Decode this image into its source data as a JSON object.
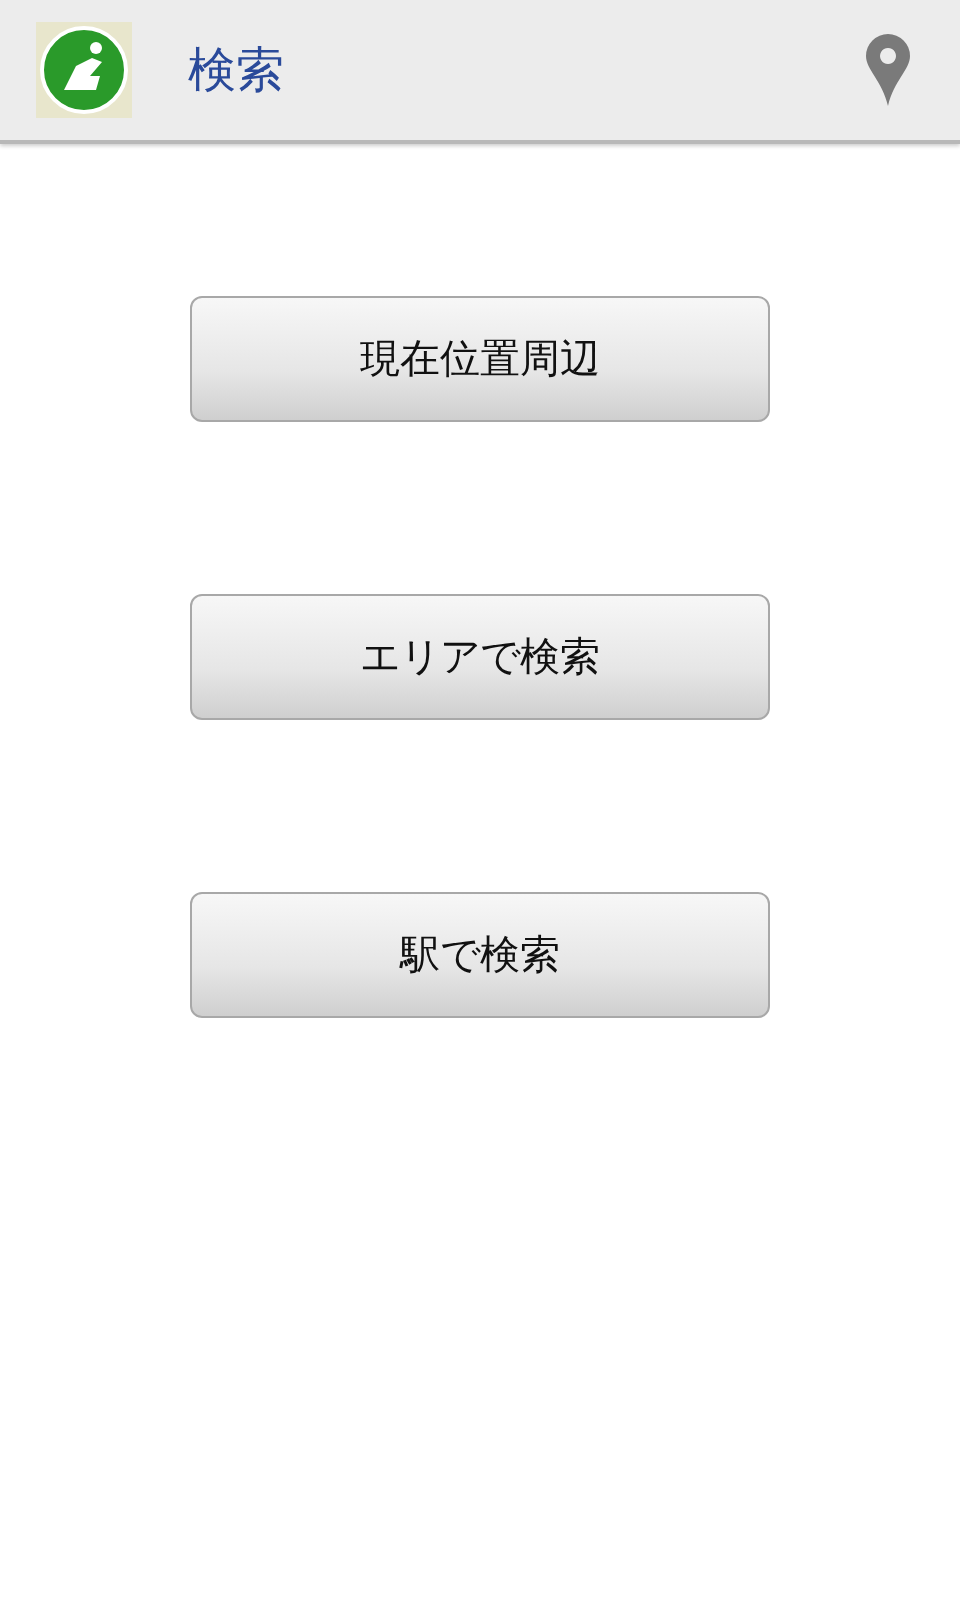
{
  "action_bar": {
    "title": "検索"
  },
  "buttons": [
    {
      "label": "現在位置周辺"
    },
    {
      "label": "エリアで検索"
    },
    {
      "label": "駅で検索"
    }
  ]
}
